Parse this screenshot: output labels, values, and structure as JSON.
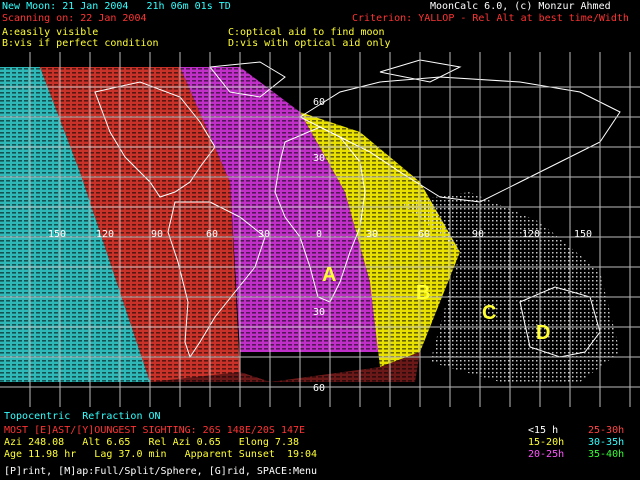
{
  "header": {
    "new_moon_line": "New Moon: 21 Jan 2004   21h 06m 01s TD",
    "app_title": "MoonCalc 6.0, (c) Monzur Ahmed",
    "scanning_line": "Scanning on: 22 Jan 2004",
    "criterion_line": "Criterion: YALLOP - Rel Alt at best time/Width",
    "legend_a": "A:easily visible",
    "legend_b": "B:vis if perfect condition",
    "legend_c": "C:optical aid to find moon",
    "legend_d": "D:vis with optical aid only"
  },
  "map": {
    "longitude_labels": [
      "150",
      "120",
      "90",
      "60",
      "30",
      "0",
      "30",
      "60",
      "90",
      "120",
      "150"
    ],
    "latitude_labels": [
      "60",
      "30",
      "30",
      "60"
    ],
    "zone_letters": [
      "A",
      "B",
      "C",
      "D"
    ]
  },
  "footer": {
    "topocentric": "Topocentric  Refraction ON",
    "most_sighting": "MOST [E]AST/[Y]OUNGEST SIGHTING: 26S 148E/20S 147E",
    "azi_line": "Azi 248.08   Alt 6.65   Rel Azi 0.65   Elong 7.38",
    "age_line": "Age 11.98 hr   Lag 37.0 min   Apparent Sunset  19:04",
    "lag_legend": [
      {
        "label": "<15 h",
        "color": "#ffffff"
      },
      {
        "label": "25-30h",
        "color": "#ff4444"
      },
      {
        "label": "15-20h",
        "color": "#ffff33"
      },
      {
        "label": "30-35h",
        "color": "#33ffff"
      },
      {
        "label": "20-25h",
        "color": "#ff55ff"
      },
      {
        "label": "35-40h",
        "color": "#33ff33"
      }
    ],
    "menu": "[P]rint, [M]ap:Full/Split/Sphere, [G]rid, SPACE:Menu"
  },
  "colors": {
    "header_cyan": "#33ffff",
    "header_yellow": "#ffff33",
    "header_red": "#ff3333",
    "zone_cyan": "#2fb8b8",
    "zone_red": "#c83228",
    "zone_magenta": "#c030c8",
    "zone_yellow": "#e8e000",
    "zone_white": "#e8e8e8"
  }
}
